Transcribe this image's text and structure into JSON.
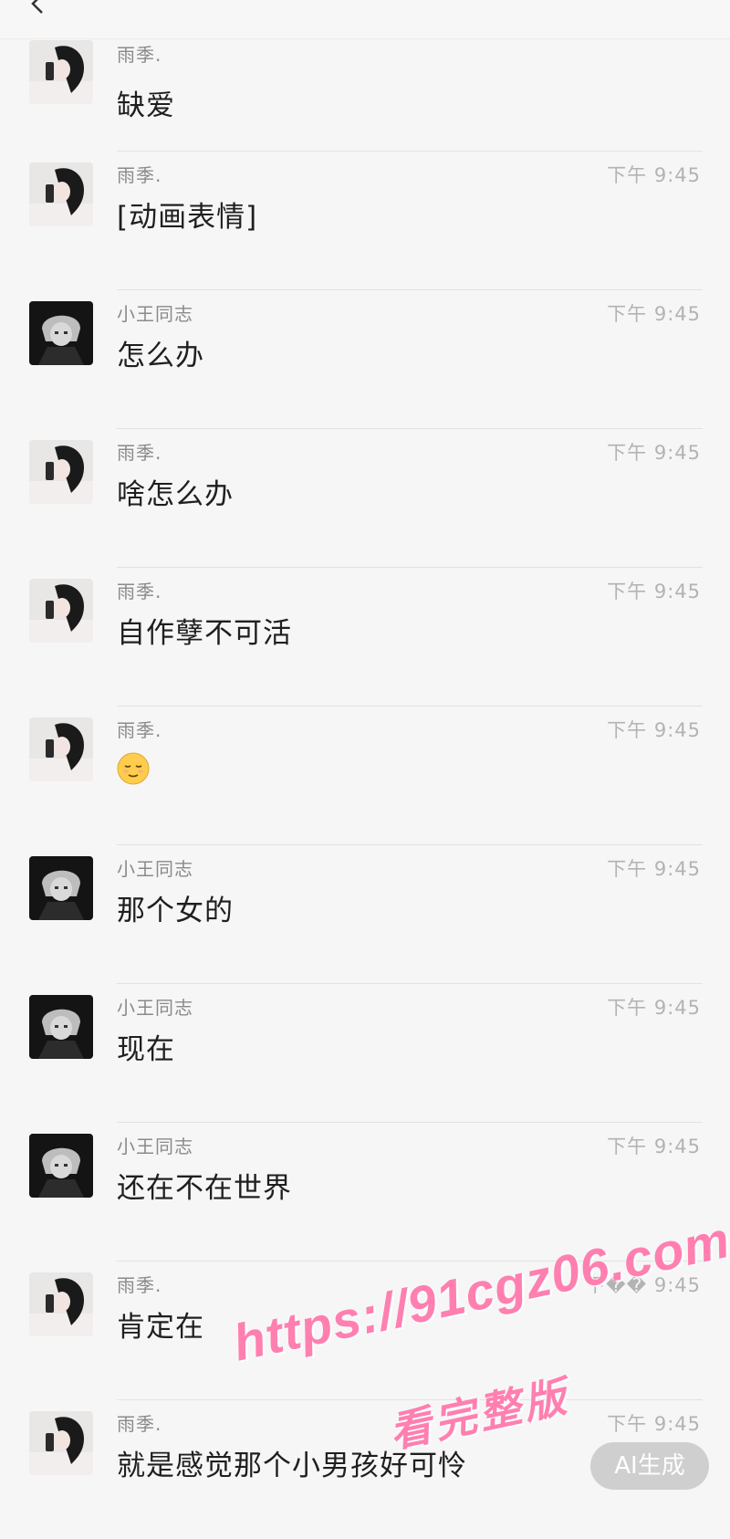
{
  "header": {
    "back_icon": "chevron-left-icon"
  },
  "messages": [
    {
      "sender": "雨季.",
      "time": "",
      "text": "缺爱",
      "avatar": "girl"
    },
    {
      "sender": "雨季.",
      "time": "下午 9:45",
      "text": "[动画表情]",
      "avatar": "girl"
    },
    {
      "sender": "小王同志",
      "time": "下午 9:45",
      "text": "怎么办",
      "avatar": "boy"
    },
    {
      "sender": "雨季.",
      "time": "下午 9:45",
      "text": "啥怎么办",
      "avatar": "girl"
    },
    {
      "sender": "雨季.",
      "time": "下午 9:45",
      "text": "自作孽不可活",
      "avatar": "girl"
    },
    {
      "sender": "雨季.",
      "time": "下午 9:45",
      "text": "",
      "emoji": "relieved-face-emoji",
      "avatar": "girl"
    },
    {
      "sender": "小王同志",
      "time": "下午 9:45",
      "text": "那个女的",
      "avatar": "boy"
    },
    {
      "sender": "小王同志",
      "time": "下午 9:45",
      "text": "现在",
      "avatar": "boy"
    },
    {
      "sender": "小王同志",
      "time": "下午 9:45",
      "text": "还在不在世界",
      "avatar": "boy"
    },
    {
      "sender": "雨季.",
      "time": "下�� 9:45",
      "text": "肯定在",
      "avatar": "girl"
    },
    {
      "sender": "雨季.",
      "time": "下午 9:45",
      "text": "就是感觉那个小男孩好可怜",
      "avatar": "girl"
    }
  ],
  "watermark": {
    "url": "https://91cgz06.com",
    "subtitle": "看完整版"
  },
  "ai_badge": "AI生成"
}
